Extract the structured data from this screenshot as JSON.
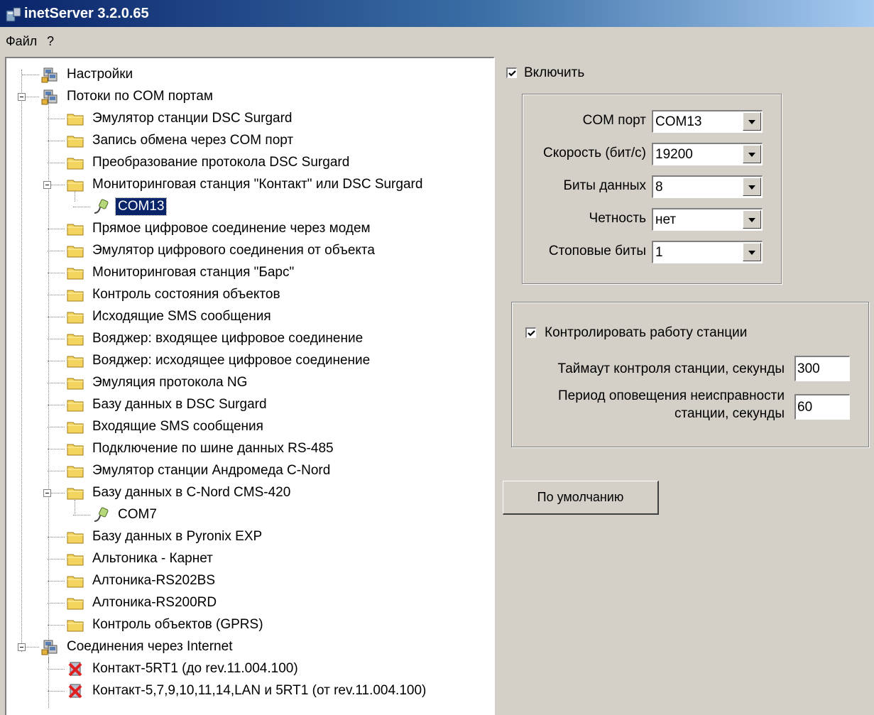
{
  "window": {
    "title": "inetServer 3.2.0.65"
  },
  "menu": {
    "items": [
      "Файл",
      "?"
    ]
  },
  "tree": {
    "nodes": [
      {
        "label": "Настройки",
        "icon": "settings-node-icon"
      },
      {
        "label": "Потоки по COM портам",
        "icon": "settings-node-icon"
      },
      {
        "label": "Эмулятор станции DSC Surgard",
        "icon": "folder-icon"
      },
      {
        "label": "Запись обмена через COM порт",
        "icon": "folder-icon"
      },
      {
        "label": "Преобразование протокола DSC Surgard",
        "icon": "folder-icon"
      },
      {
        "label": "Мониторинговая станция \"Контакт\" или DSC Surgard",
        "icon": "folder-icon"
      },
      {
        "label": "COM13",
        "icon": "serial-port-icon",
        "selected": true
      },
      {
        "label": "Прямое цифровое соединение через модем",
        "icon": "folder-icon"
      },
      {
        "label": "Эмулятор цифрового соединения от объекта",
        "icon": "folder-icon"
      },
      {
        "label": "Мониторинговая станция \"Барс\"",
        "icon": "folder-icon"
      },
      {
        "label": "Контроль состояния объектов",
        "icon": "folder-icon"
      },
      {
        "label": "Исходящие SMS сообщения",
        "icon": "folder-icon"
      },
      {
        "label": "Вояджер: входящее цифровое соединение",
        "icon": "folder-icon"
      },
      {
        "label": "Вояджер: исходящее цифровое соединение",
        "icon": "folder-icon"
      },
      {
        "label": "Эмуляция протокола NG",
        "icon": "folder-icon"
      },
      {
        "label": "Базу данных в DSC Surgard",
        "icon": "folder-icon"
      },
      {
        "label": "Входящие SMS сообщения",
        "icon": "folder-icon"
      },
      {
        "label": "Подключение по шине данных RS-485",
        "icon": "folder-icon"
      },
      {
        "label": "Эмулятор станции Андромеда C-Nord",
        "icon": "folder-icon"
      },
      {
        "label": "Базу данных в C-Nord CMS-420",
        "icon": "folder-icon"
      },
      {
        "label": "COM7",
        "icon": "serial-port-icon"
      },
      {
        "label": "Базу данных в Pyronix EXP",
        "icon": "folder-icon"
      },
      {
        "label": "Альтоника - Карнет",
        "icon": "folder-icon"
      },
      {
        "label": "Алтоника-RS202BS",
        "icon": "folder-icon"
      },
      {
        "label": "Алтоника-RS200RD",
        "icon": "folder-icon"
      },
      {
        "label": "Контроль объектов (GPRS)",
        "icon": "folder-icon"
      },
      {
        "label": "Соединения через Internet",
        "icon": "settings-node-icon"
      },
      {
        "label": "Контакт-5RT1 (до rev.11.004.100)",
        "icon": "disabled-connection-icon"
      },
      {
        "label": "Контакт-5,7,9,10,11,14,LAN и 5RT1 (от rev.11.004.100)",
        "icon": "disabled-connection-icon"
      }
    ]
  },
  "settings": {
    "enable_label": "Включить",
    "enable_checked": true,
    "port": {
      "com_label": "COM порт",
      "com_value": "COM13",
      "speed_label": "Скорость (бит/с)",
      "speed_value": "19200",
      "bits_label": "Биты данных",
      "bits_value": "8",
      "parity_label": "Четность",
      "parity_value": "нет",
      "stop_label": "Стоповые биты",
      "stop_value": "1"
    },
    "monitor": {
      "check_label": "Контролировать работу станции",
      "check_checked": true,
      "timeout_label": "Таймаут контроля станции, секунды",
      "timeout_value": "300",
      "period_label_1": "Период оповещения неисправности",
      "period_label_2": "станции, секунды",
      "period_value": "60"
    },
    "default_button": "По умолчанию"
  }
}
